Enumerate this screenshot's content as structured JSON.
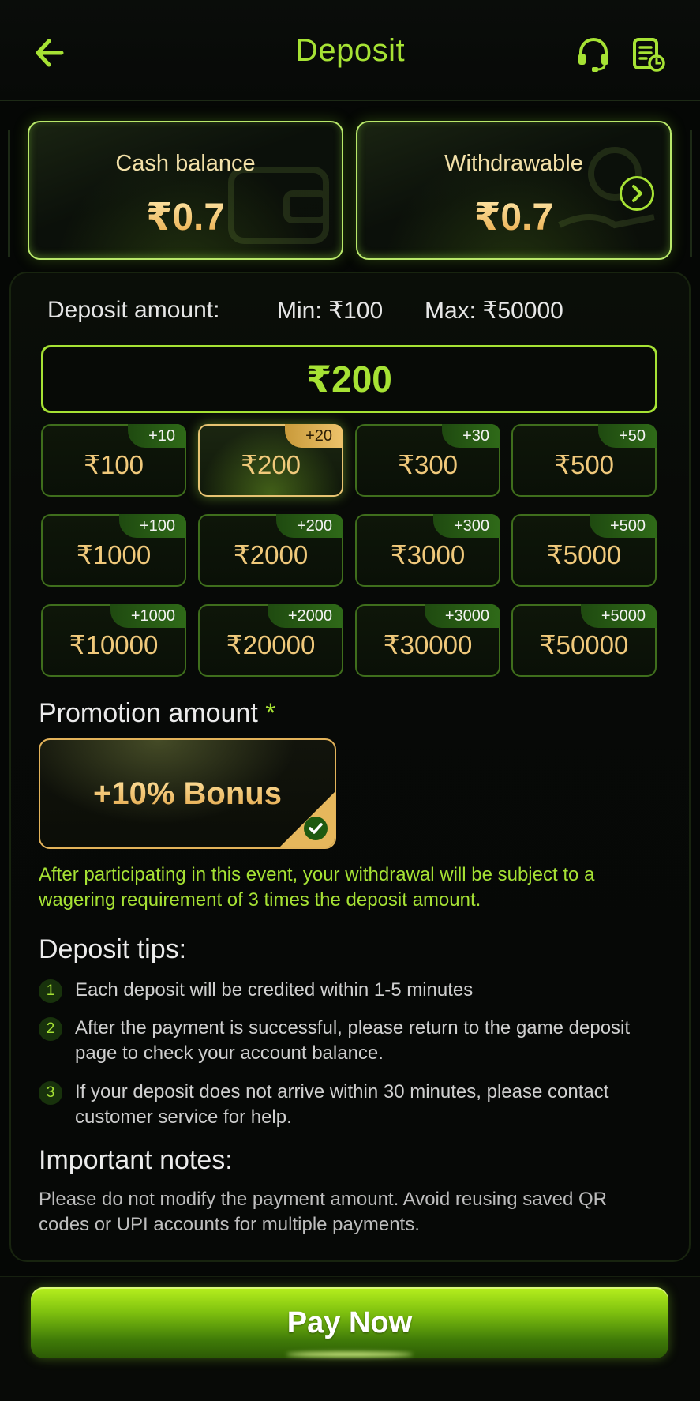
{
  "header": {
    "title": "Deposit",
    "back_icon": "back-arrow-icon",
    "support_icon": "headset-icon",
    "records_icon": "deposit-records-icon"
  },
  "balances": {
    "cash": {
      "label": "Cash balance",
      "value": "₹0.7"
    },
    "withdrawable": {
      "label": "Withdrawable",
      "value": "₹0.7"
    }
  },
  "deposit": {
    "label": "Deposit amount:",
    "min": "Min: ₹100",
    "max": "Max: ₹50000",
    "input_value": "₹200",
    "chips": [
      {
        "amount": "₹100",
        "bonus": "+10"
      },
      {
        "amount": "₹200",
        "bonus": "+20",
        "selected": true
      },
      {
        "amount": "₹300",
        "bonus": "+30"
      },
      {
        "amount": "₹500",
        "bonus": "+50"
      },
      {
        "amount": "₹1000",
        "bonus": "+100"
      },
      {
        "amount": "₹2000",
        "bonus": "+200"
      },
      {
        "amount": "₹3000",
        "bonus": "+300"
      },
      {
        "amount": "₹5000",
        "bonus": "+500"
      },
      {
        "amount": "₹10000",
        "bonus": "+1000"
      },
      {
        "amount": "₹20000",
        "bonus": "+2000"
      },
      {
        "amount": "₹30000",
        "bonus": "+3000"
      },
      {
        "amount": "₹50000",
        "bonus": "+5000"
      }
    ]
  },
  "promotion": {
    "title": "Promotion amount",
    "required_mark": "*",
    "option": "+10% Bonus",
    "note": "After participating in this event, your withdrawal will be subject to a wagering requirement of 3 times the deposit amount."
  },
  "tips": {
    "title": "Deposit tips:",
    "items": [
      {
        "num": "1",
        "text": "Each deposit will be credited within 1-5 minutes"
      },
      {
        "num": "2",
        "text": "After the payment is successful, please return to the game deposit page to check your account balance."
      },
      {
        "num": "3",
        "text": "If your deposit does not arrive within 30 minutes, please contact customer service for help."
      }
    ]
  },
  "notes": {
    "title": "Important notes:",
    "text": "Please do not modify the payment amount. Avoid reusing saved QR codes or UPI accounts for multiple payments."
  },
  "footer": {
    "pay_label": "Pay Now"
  },
  "colors": {
    "accent": "#a6e234",
    "gold": "#f0c97b",
    "background": "#050705"
  }
}
